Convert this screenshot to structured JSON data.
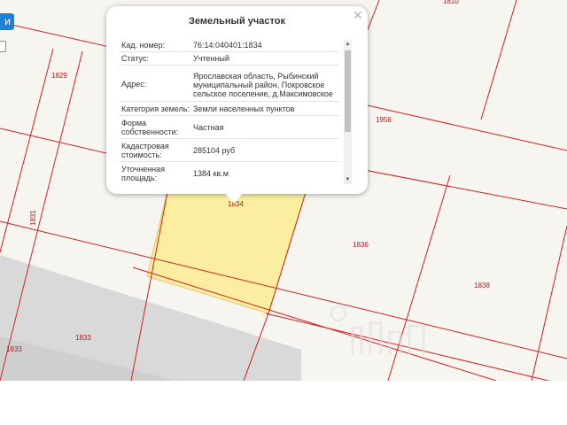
{
  "map": {
    "zoom_button_label": "и",
    "parcels": [
      {
        "id": "1829",
        "kind": "parcel"
      },
      {
        "id": "1831",
        "kind": "parcel"
      },
      {
        "id": "1833",
        "kind": "parcel"
      },
      {
        "id": "1833b",
        "label": "1833",
        "kind": "parcel"
      },
      {
        "id": "1834",
        "kind": "selected-parcel"
      },
      {
        "id": "1836",
        "kind": "parcel"
      },
      {
        "id": "1838",
        "kind": "parcel"
      },
      {
        "id": "1956",
        "kind": "parcel"
      },
      {
        "id": "1810",
        "kind": "parcel"
      }
    ],
    "labels": {
      "p1829": "1829",
      "p1831": "1831",
      "p1833a": "1833",
      "p1833b": "1833",
      "p1834": "1834",
      "p1836": "1836",
      "p1838": "1838",
      "p1956": "1956",
      "p1810": "1810"
    },
    "colors": {
      "boundary": "#d02020",
      "selected_fill": "#fbeeA0",
      "selected_border": "#e8c85a",
      "road": "#d9d9d9",
      "background": "#f7f5f0"
    }
  },
  "popup": {
    "title": "Земельный участок",
    "rows": [
      {
        "key": "Кад. номер:",
        "value": "76:14:040401:1834"
      },
      {
        "key": "Статус:",
        "value": "Учтенный"
      },
      {
        "key": "Адрес:",
        "value": "Ярославская область, Рыбинский муниципальный район, Покровское сельское поселение, д.Максимовское"
      },
      {
        "key": "Категория земель:",
        "value": "Земли населенных пунктов"
      },
      {
        "key": "Форма собственности:",
        "value": "Частная"
      },
      {
        "key": "Кадастровая стоимость:",
        "value": "285104 руб"
      },
      {
        "key": "Уточненная площадь:",
        "value": "1384 кв.м"
      }
    ]
  }
}
